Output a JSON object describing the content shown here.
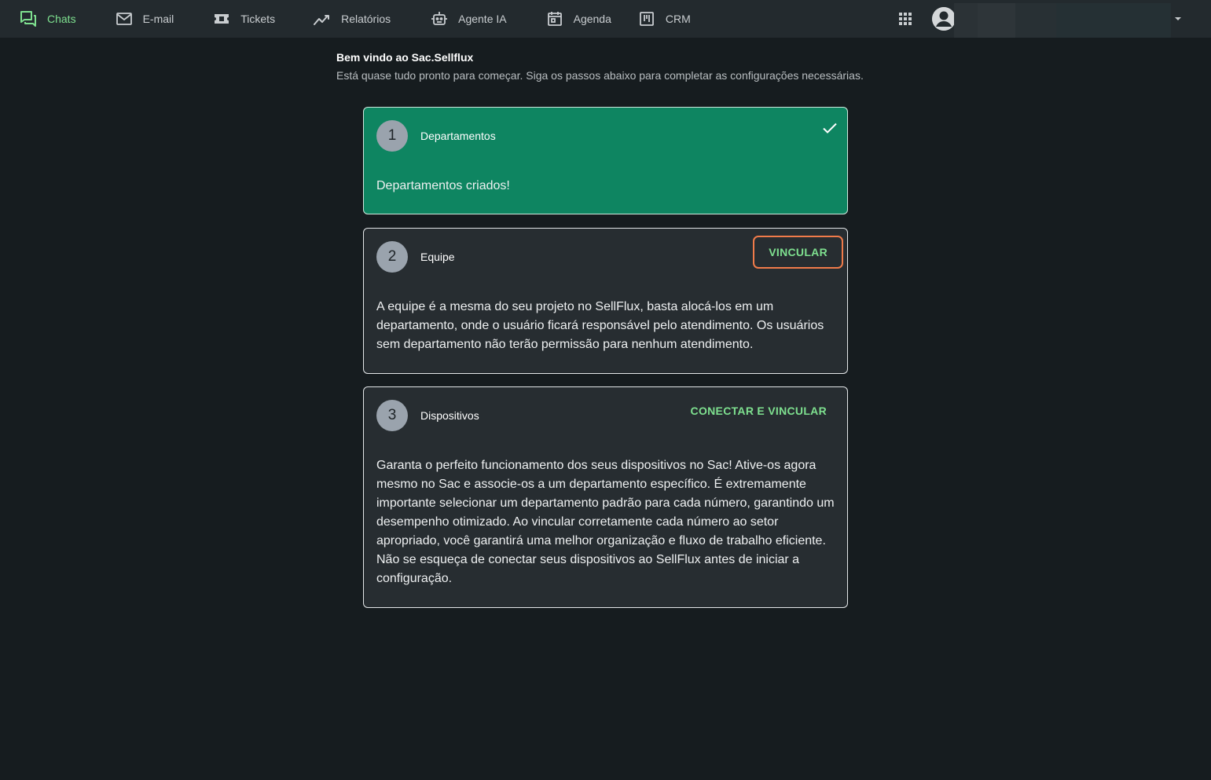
{
  "nav": {
    "items": [
      {
        "label": "Chats",
        "icon": "chat-bubbles-icon",
        "active": true
      },
      {
        "label": "E-mail",
        "icon": "mail-icon",
        "active": false
      },
      {
        "label": "Tickets",
        "icon": "ticket-icon",
        "active": false
      },
      {
        "label": "Relatórios",
        "icon": "chart-line-icon",
        "active": false
      },
      {
        "label": "Agente IA",
        "icon": "robot-icon",
        "active": false
      },
      {
        "label": "Agenda",
        "icon": "calendar-icon",
        "active": false
      },
      {
        "label": "CRM",
        "icon": "kanban-icon",
        "active": false
      }
    ]
  },
  "header": {
    "apps_icon": "apps-grid-icon",
    "avatar_icon": "account-circle-icon",
    "menu_icon": "chevron-down-icon"
  },
  "welcome": {
    "title": "Bem vindo ao Sac.Sellflux",
    "subtitle": "Está quase tudo pronto para começar. Siga os passos abaixo para completar as configurações necessárias."
  },
  "steps": [
    {
      "number": "1",
      "title": "Departamentos",
      "body": "Departamentos criados!",
      "completed": true,
      "status_icon": "check-icon"
    },
    {
      "number": "2",
      "title": "Equipe",
      "action": "VINCULAR",
      "body": "A equipe é a mesma do seu projeto no SellFlux, basta alocá-los em um departamento, onde o usuário ficará responsável pelo atendimento. Os usuários sem departamento não terão permissão para nenhum atendimento.",
      "completed": false
    },
    {
      "number": "3",
      "title": "Dispositivos",
      "action": "CONECTAR E VINCULAR",
      "body": "Garanta o perfeito funcionamento dos seus dispositivos no Sac! Ative-os agora mesmo no Sac e associe-os a um departamento específico. É extremamente importante selecionar um departamento padrão para cada número, garantindo um desempenho otimizado. Ao vincular corretamente cada número ao setor apropriado, você garantirá uma melhor organização e fluxo de trabalho eficiente. Não se esqueça de conectar seus dispositivos ao SellFlux antes de iniciar a configuração.",
      "completed": false
    }
  ],
  "colors": {
    "accent": "#7ee08f",
    "completed_card": "#0e8561",
    "focus_ring": "#f07b4a",
    "background": "#161c1f",
    "topbar": "#232a2e"
  }
}
